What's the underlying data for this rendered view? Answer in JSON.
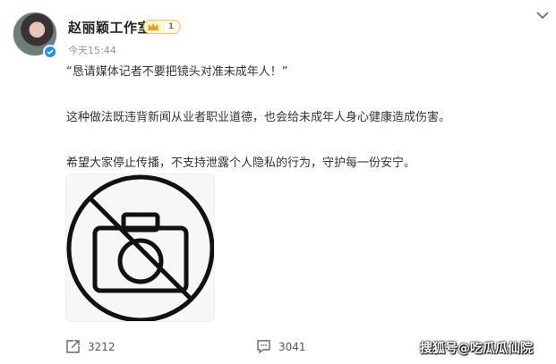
{
  "post": {
    "author": "赵丽颖工作室",
    "vip_level": "1",
    "time": "今天15:44",
    "paragraphs": [
      "“恳请媒体记者不要把镜头对准未成年人！”",
      "这种做法既违背新闻从业者职业道德，也会给未成年人身心健康造成伤害。",
      "希望大家停止传播，不支持泄露个人隐私的行为，守护每一份安宁。"
    ],
    "image_icon": "no-camera-icon"
  },
  "actions": {
    "repost_count": "3212",
    "comment_count": "3041"
  },
  "watermark": "搜狐号@吃瓜瓜仙院",
  "colors": {
    "text": "#333333",
    "muted": "#939393",
    "verified": "#1e8ff5",
    "badge_gold": "#f0c660"
  }
}
